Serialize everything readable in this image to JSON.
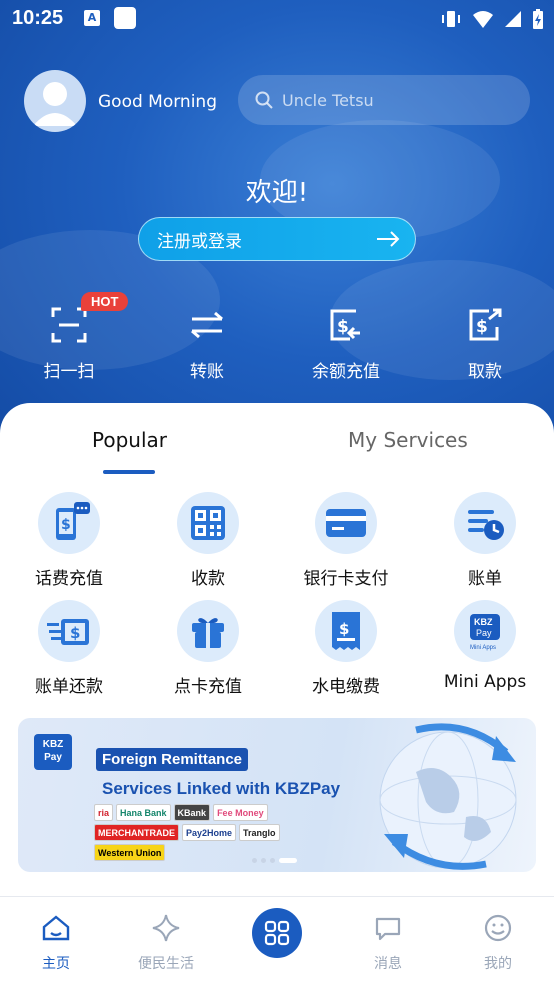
{
  "status_bar": {
    "time": "10:25",
    "notif_icon_a": "A"
  },
  "header": {
    "greeting": "Good Morning",
    "search_placeholder": "Uncle Tetsu",
    "welcome": "欢迎!",
    "login_label": "注册或登录"
  },
  "quick_actions": [
    {
      "label": "扫一扫",
      "icon": "scan-icon",
      "badge": "HOT"
    },
    {
      "label": "转账",
      "icon": "transfer-icon"
    },
    {
      "label": "余额充值",
      "icon": "top-up-icon"
    },
    {
      "label": "取款",
      "icon": "withdraw-icon"
    }
  ],
  "tabs": [
    {
      "label": "Popular",
      "active": true
    },
    {
      "label": "My Services",
      "active": false
    }
  ],
  "services": [
    {
      "label": "话费充值",
      "icon": "phone-topup-icon"
    },
    {
      "label": "收款",
      "icon": "qr-code-icon"
    },
    {
      "label": "银行卡支付",
      "icon": "bank-card-icon"
    },
    {
      "label": "账单",
      "icon": "bill-clock-icon"
    },
    {
      "label": "账单还款",
      "icon": "bill-repay-icon"
    },
    {
      "label": "点卡充值",
      "icon": "gift-icon"
    },
    {
      "label": "水电缴费",
      "icon": "utility-bill-icon"
    },
    {
      "label": "Mini Apps",
      "icon": "mini-apps-icon"
    }
  ],
  "banner": {
    "logo_text_1": "KBZ",
    "logo_text_2": "Pay",
    "title": "Foreign Remittance",
    "subtitle": "Services Linked with KBZPay",
    "partners": [
      "ria",
      "Hana Bank",
      "KBank",
      "Fee Money",
      "MERCHANTRADE",
      "Pay2Home",
      "Tranglo",
      "Western Union"
    ],
    "slide_count": 4,
    "active_slide": 4
  },
  "bottom_nav": [
    {
      "label": "主页",
      "icon": "home-icon",
      "active": true
    },
    {
      "label": "便民生活",
      "icon": "sparkle-icon",
      "active": false
    },
    {
      "label": "",
      "icon": "apps-grid-icon",
      "active": false
    },
    {
      "label": "消息",
      "icon": "message-icon",
      "active": false
    },
    {
      "label": "我的",
      "icon": "smile-icon",
      "active": false
    }
  ],
  "colors": {
    "primary": "#1b5cc0",
    "hot_badge": "#e9413a",
    "service_bg": "#dcebfb"
  }
}
